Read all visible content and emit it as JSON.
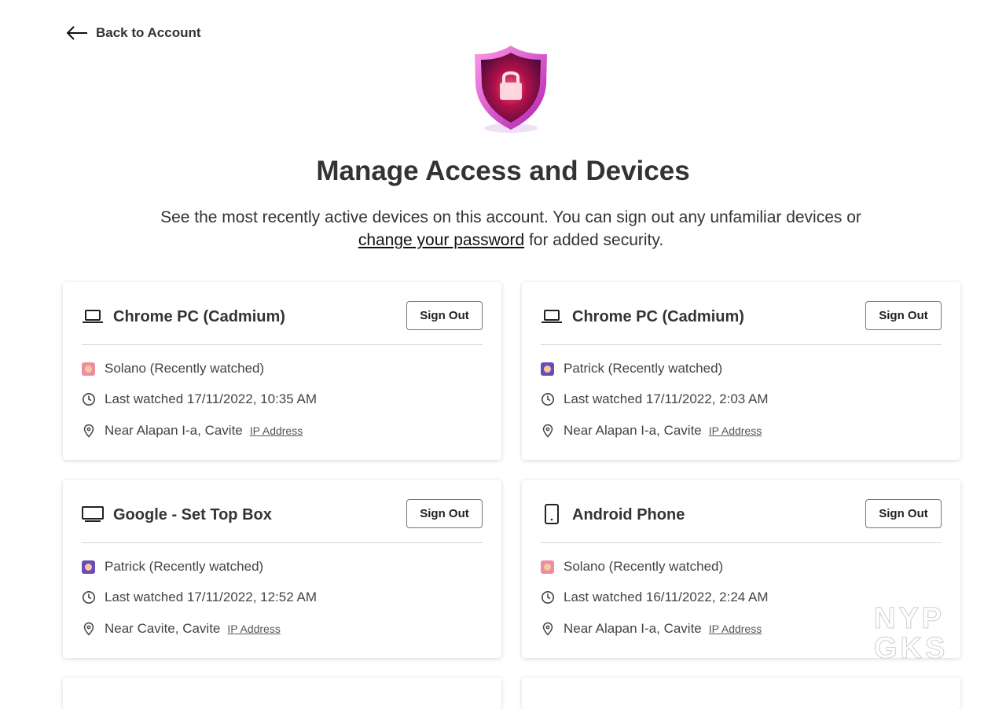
{
  "back_label": "Back to Account",
  "title": "Manage Access and Devices",
  "subtitle": {
    "before": "See the most recently active devices on this account. You can sign out any unfamiliar devices or ",
    "link": "change your password",
    "after": " for added security."
  },
  "devices": [
    {
      "name": "Chrome PC (Cadmium)",
      "icon": "laptop-icon",
      "sign_out": "Sign Out",
      "profile": "Solano (Recently watched)",
      "avatar_color": "#f08ca0",
      "last_watched": "Last watched 17/11/2022, 10:35 AM",
      "location": "Near Alapan I-a, Cavite",
      "ip_label": "IP Address"
    },
    {
      "name": "Chrome PC (Cadmium)",
      "icon": "laptop-icon",
      "sign_out": "Sign Out",
      "profile": "Patrick (Recently watched)",
      "avatar_color": "#6b4bb7",
      "last_watched": "Last watched 17/11/2022, 2:03 AM",
      "location": "Near Alapan I-a, Cavite",
      "ip_label": "IP Address"
    },
    {
      "name": "Google - Set Top Box",
      "icon": "tv-icon",
      "sign_out": "Sign Out",
      "profile": "Patrick (Recently watched)",
      "avatar_color": "#6b4bb7",
      "last_watched": "Last watched 17/11/2022, 12:52 AM",
      "location": "Near Cavite, Cavite",
      "ip_label": "IP Address"
    },
    {
      "name": "Android Phone",
      "icon": "phone-icon",
      "sign_out": "Sign Out",
      "profile": "Solano (Recently watched)",
      "avatar_color": "#f08ca0",
      "last_watched": "Last watched 16/11/2022, 2:24 AM",
      "location": "Near Alapan I-a, Cavite",
      "ip_label": "IP Address"
    }
  ],
  "watermark": [
    "NYP",
    "GKS"
  ]
}
